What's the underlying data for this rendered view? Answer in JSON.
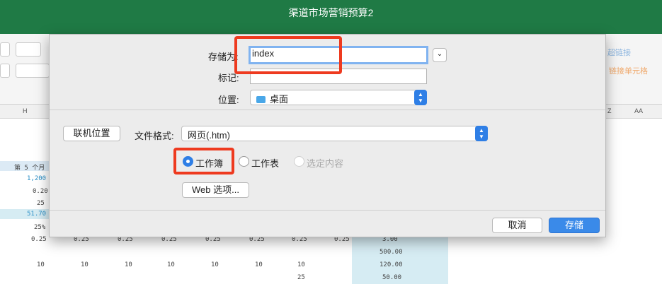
{
  "window": {
    "title": "渠道市场营销预算2"
  },
  "ribbon": {
    "link_top": "超链接",
    "link_bottom": "链接单元格"
  },
  "sheet": {
    "col_h": "H",
    "col_z": "Z",
    "col_aa": "AA",
    "month_header": "第 5 个月",
    "col_values": [
      "1,200",
      "0.20",
      "25",
      "51.70",
      "25%",
      "0.25"
    ],
    "row_quarter": [
      "0.25",
      "0.25",
      "0.25",
      "0.25",
      "0.25",
      "0.25",
      "0.25"
    ],
    "row_tens": [
      "10",
      "10",
      "10",
      "10",
      "10",
      "10",
      "10"
    ],
    "right_totals": [
      "3.00",
      "500.00",
      "120.00",
      "50.00"
    ],
    "lone_25": "25"
  },
  "dialog": {
    "save_as_label": "存储为:",
    "save_as_value": "index",
    "tags_label": "标记:",
    "tags_value": "",
    "location_label": "位置:",
    "location_value": "桌面",
    "online_button": "联机位置",
    "format_label": "文件格式:",
    "format_value": "网页(.htm)",
    "radio_workbook": "工作簿",
    "radio_sheet": "工作表",
    "radio_selection": "选定内容",
    "web_options": "Web 选项...",
    "cancel": "取消",
    "save": "存储"
  },
  "colors": {
    "titlebar": "#1f7a45",
    "accent": "#2f7fe6",
    "highlight": "#ee3a1f"
  }
}
